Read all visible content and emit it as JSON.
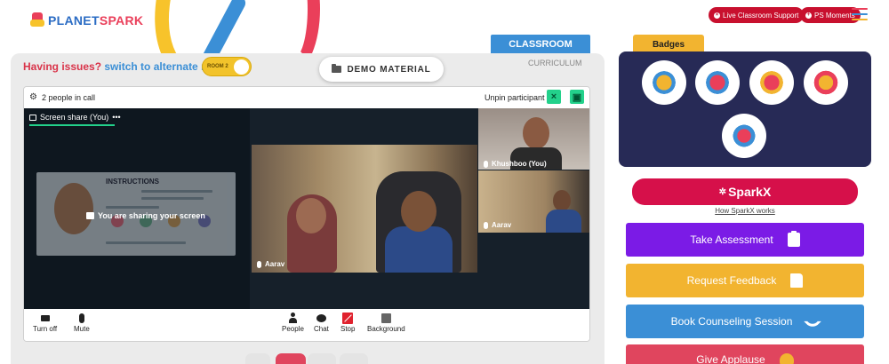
{
  "header": {
    "logo_part1": "PLANET",
    "logo_part2": "SPARK",
    "live_support_label": "Live Classroom Support",
    "ps_moments_label": "PS Moments",
    "hamburger_colors": [
      "#ea3f5a",
      "#3b8fd6",
      "#f2b430"
    ]
  },
  "tabs": {
    "classroom": "CLASSROOM",
    "curriculum": "CURRICULUM"
  },
  "issues": {
    "prefix": "Having issues?",
    "link": "switch to alternate room",
    "room_label": "ROOM 2"
  },
  "demo_material": "DEMO MATERIAL",
  "meeting": {
    "people_count": "2 people in call",
    "unpin_label": "Unpin participant",
    "screen_share_label": "Screen share (You)",
    "share_more": "•••",
    "preview_title": "INSTRUCTIONS",
    "sharing_message": "You are sharing your screen",
    "main_participant": "Aarav",
    "side_participants": [
      "Khushboo (You)",
      "Aarav"
    ],
    "controls": {
      "turn_off": "Turn off",
      "mute": "Mute",
      "people": "People",
      "chat": "Chat",
      "stop": "Stop",
      "background": "Background"
    }
  },
  "badges": {
    "title": "Badges",
    "items": [
      "trophy-badge",
      "fist-badge",
      "meditation-badge",
      "idea-badge",
      "robot-badge"
    ]
  },
  "sparkx": {
    "label": "SparkX",
    "link": "How SparkX works"
  },
  "actions": [
    {
      "label": "Take Assessment",
      "color": "#7b1be6",
      "icon": "clipboard-icon"
    },
    {
      "label": "Request Feedback",
      "color": "#f2b430",
      "icon": "document-icon"
    },
    {
      "label": "Book Counseling Session",
      "color": "#3b8fd6",
      "icon": "phone-icon"
    },
    {
      "label": "Give Applause",
      "color": "#e0455e",
      "icon": "clap-icon"
    }
  ],
  "colors": {
    "brand_blue": "#3b8fd6",
    "brand_red": "#ea3f5a",
    "brand_yellow": "#f2b430",
    "badges_bg": "#272a56",
    "sparkx": "#d6104a"
  }
}
